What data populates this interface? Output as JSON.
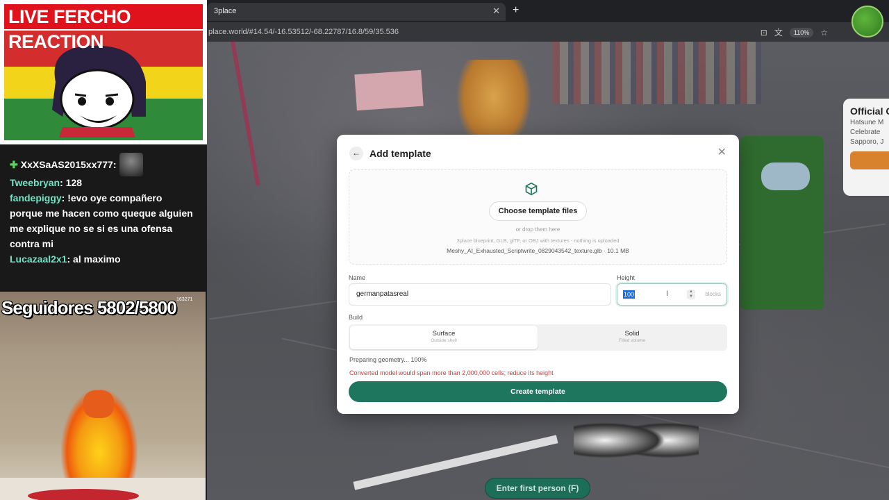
{
  "browser": {
    "tab_title": "3place",
    "tab_close": "✕",
    "new_tab": "+",
    "url": "place.world/#14.54/-16.53512/-68.22787/16.8/59/35.536",
    "zoom": "110%"
  },
  "scene": {
    "info_card": {
      "title": "Official C",
      "line1": "Hatsune M",
      "line2": "Celebrate ",
      "line3": "Sapporo, J"
    },
    "first_person_button": "Enter first person (F)"
  },
  "modal": {
    "title": "Add template",
    "back_icon": "←",
    "close_icon": "✕",
    "choose_button": "Choose template files",
    "drop_hint": "or drop them here",
    "formats_hint": "3place blueprint, GLB, glTF, or OBJ with textures - nothing is uploaded",
    "file_info": "Meshy_AI_Exhausted_Scriptwrite_0829043542_texture.glb · 10.1 MB",
    "name_label": "Name",
    "name_value": "germanpatasreal",
    "height_label": "Height",
    "height_value": "100",
    "height_unit": "blocks",
    "build_label": "Build",
    "build_options": [
      {
        "label": "Surface",
        "sub": "Outside shell",
        "selected": true
      },
      {
        "label": "Solid",
        "sub": "Filled volume",
        "selected": false
      }
    ],
    "progress_text": "Preparing geometry... 100%",
    "error_text": "Converted model would span more than 2,000,000 cells; reduce its height",
    "create_button": "Create template",
    "accent_color": "#1e765f",
    "error_color": "#d23b3b"
  },
  "stream": {
    "cam_title": "LIVE FERCHO REACTION",
    "chat": {
      "first_user": "XxXSaAS2015xx777:",
      "messages": [
        {
          "user": "Tweebryan",
          "text": ": 128"
        },
        {
          "user": "fandepiggy",
          "text": ": !evo oye compañero porque me hacen como queque alguien me explique no se si es una ofensa contra mi"
        },
        {
          "user": "Lucazaal2x1",
          "text": ": al maximo"
        }
      ]
    },
    "followers": "Seguidores 5802/5800",
    "game_counter": "163271"
  }
}
